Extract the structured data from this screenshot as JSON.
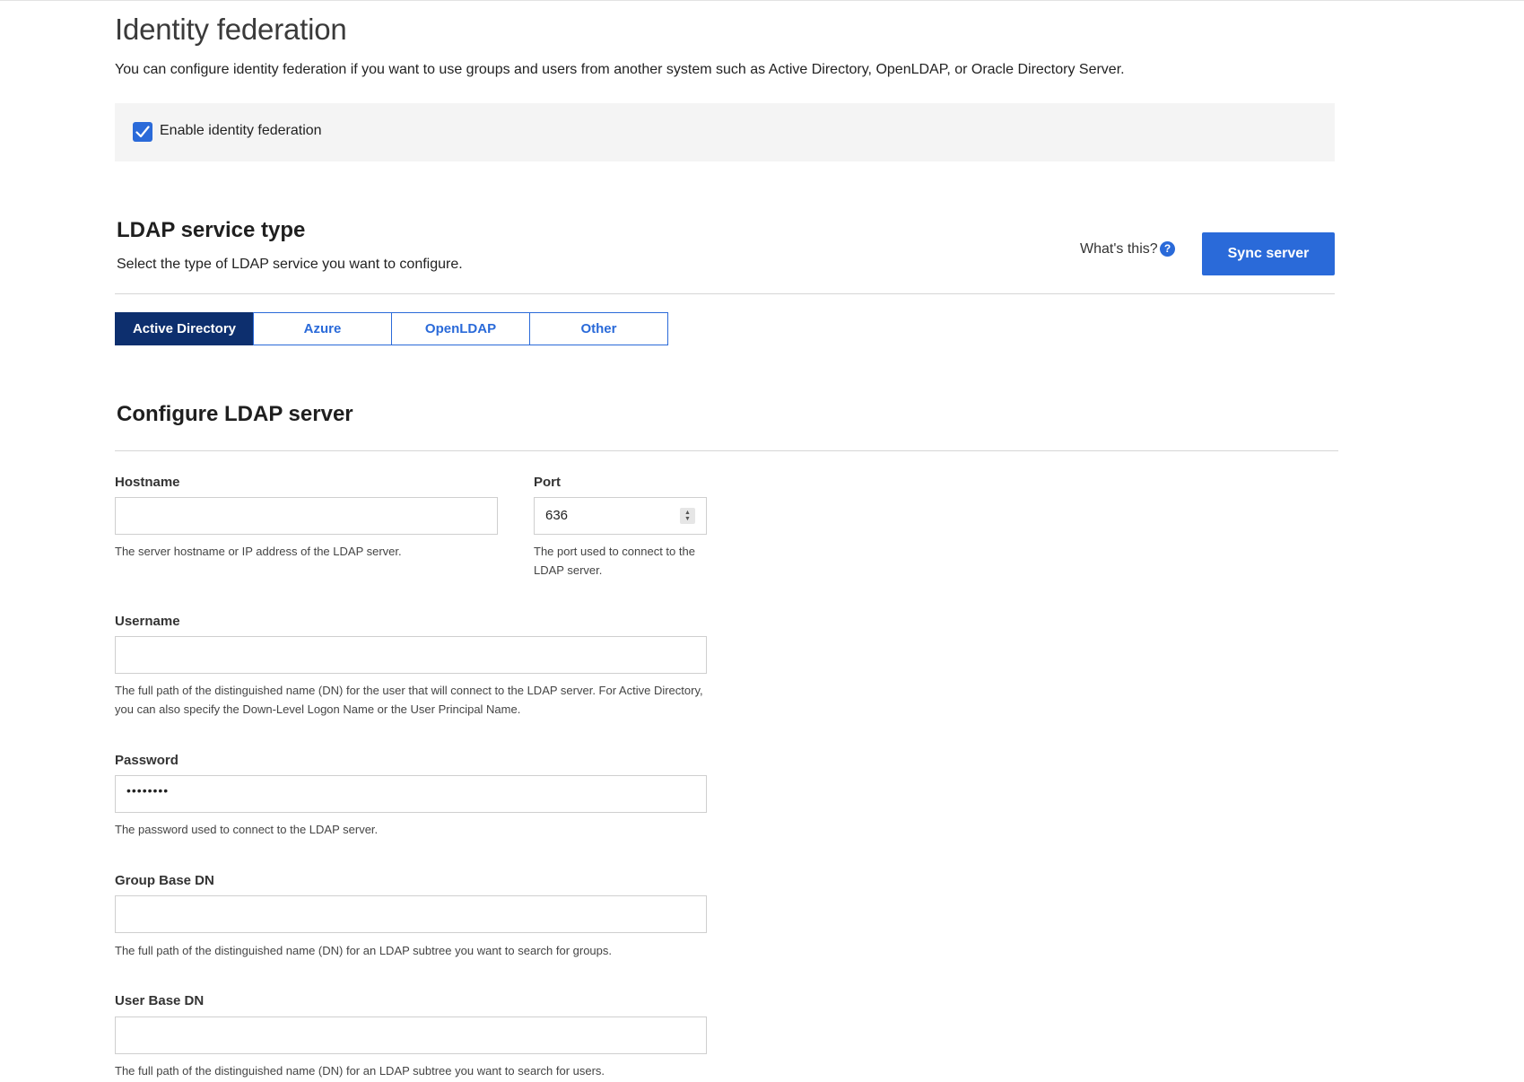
{
  "page": {
    "title": "Identity federation",
    "description": "You can configure identity federation if you want to use groups and users from another system such as Active Directory, OpenLDAP, or Oracle Directory Server.",
    "enable_label": "Enable identity federation",
    "enable_checked": true
  },
  "ldap_service": {
    "title": "LDAP service type",
    "description": "Select the type of LDAP service you want to configure.",
    "whats_this": "What's this?",
    "help_icon": "?",
    "sync_button": "Sync server",
    "tabs": [
      {
        "label": "Active Directory",
        "active": true
      },
      {
        "label": "Azure",
        "active": false
      },
      {
        "label": "OpenLDAP",
        "active": false
      },
      {
        "label": "Other",
        "active": false
      }
    ]
  },
  "configure": {
    "title": "Configure LDAP server",
    "hostname": {
      "label": "Hostname",
      "value": "",
      "hint": "The server hostname or IP address of the LDAP server."
    },
    "port": {
      "label": "Port",
      "value": "636",
      "hint_line1": "The port used to connect to the",
      "hint_line2": "LDAP server."
    },
    "username": {
      "label": "Username",
      "value": "",
      "hint_line1": "The full path of the distinguished name (DN) for the user that will connect to the LDAP server. For Active Directory,",
      "hint_line2": "you can also specify the Down-Level Logon Name or the User Principal Name."
    },
    "password": {
      "label": "Password",
      "value": "••••••••",
      "hint": "The password used to connect to the LDAP server."
    },
    "group_base_dn": {
      "label": "Group Base DN",
      "value": "",
      "hint": "The full path of the distinguished name (DN) for an LDAP subtree you want to search for groups."
    },
    "user_base_dn": {
      "label": "User Base DN",
      "value": "",
      "hint": "The full path of the distinguished name (DN) for an LDAP subtree you want to search for users."
    }
  },
  "colors": {
    "primary": "#2a6ad9",
    "active_tab": "#0d2f6e",
    "panel_bg": "#f4f4f4"
  }
}
